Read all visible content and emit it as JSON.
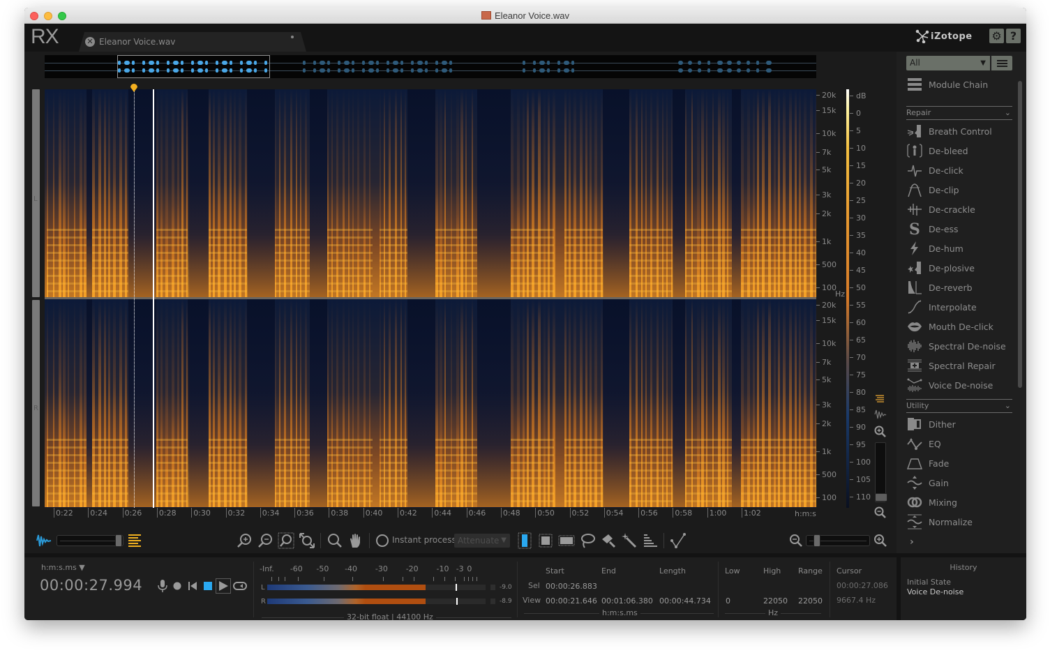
{
  "window": {
    "title": "Eleanor Voice.wav"
  },
  "app": {
    "logo": "RX",
    "brand": "iZotope",
    "settings_label": "⚙",
    "help_label": "?"
  },
  "file_tab": {
    "label": "Eleanor Voice.wav",
    "close_glyph": "✕"
  },
  "spectrogram": {
    "channels": [
      "L",
      "R"
    ],
    "freq_ticks": [
      "20k",
      "15k",
      "10k",
      "7k",
      "5k",
      "3k",
      "2k",
      "1k",
      "500",
      "100"
    ],
    "freq_unit": "Hz",
    "db_unit": "dB",
    "db_ticks": [
      "0",
      "5",
      "10",
      "15",
      "20",
      "25",
      "30",
      "35",
      "40",
      "45",
      "50",
      "55",
      "60",
      "65",
      "70",
      "75",
      "80",
      "85",
      "90",
      "95",
      "100",
      "105",
      "110"
    ],
    "time_ticks": [
      "0:22",
      "0:24",
      "0:26",
      "0:28",
      "0:30",
      "0:32",
      "0:34",
      "0:36",
      "0:38",
      "0:40",
      "0:42",
      "0:44",
      "0:46",
      "0:48",
      "0:50",
      "0:52",
      "0:54",
      "0:56",
      "0:58",
      "1:00",
      "1:02"
    ],
    "time_unit": "h:m:s",
    "colors": {
      "accent_orange": "#f0a020",
      "spectro_dark": "#0c1a38",
      "selection_blue": "#2aa8f0"
    }
  },
  "toolbar": {
    "instant_process_label": "Instant process",
    "attenuate_label": "Attenuate",
    "waveform_spectrogram_blend": 1.0
  },
  "modules": {
    "filter_value": "All",
    "module_chain_label": "Module Chain",
    "repair_header": "Repair",
    "utility_header": "Utility",
    "repair": [
      {
        "label": "Breath Control",
        "icon": "breath-icon"
      },
      {
        "label": "De-bleed",
        "icon": "mic-bleed-icon"
      },
      {
        "label": "De-click",
        "icon": "click-icon"
      },
      {
        "label": "De-clip",
        "icon": "clip-icon"
      },
      {
        "label": "De-crackle",
        "icon": "crackle-icon"
      },
      {
        "label": "De-ess",
        "icon": "ess-icon"
      },
      {
        "label": "De-hum",
        "icon": "bolt-icon"
      },
      {
        "label": "De-plosive",
        "icon": "plosive-icon"
      },
      {
        "label": "De-reverb",
        "icon": "reverb-icon"
      },
      {
        "label": "Interpolate",
        "icon": "interpolate-icon"
      },
      {
        "label": "Mouth De-click",
        "icon": "lips-icon"
      },
      {
        "label": "Spectral De-noise",
        "icon": "spectral-noise-icon"
      },
      {
        "label": "Spectral Repair",
        "icon": "spectral-repair-icon"
      },
      {
        "label": "Voice De-noise",
        "icon": "voice-noise-icon"
      }
    ],
    "utility": [
      {
        "label": "Dither",
        "icon": "dither-icon"
      },
      {
        "label": "EQ",
        "icon": "eq-icon"
      },
      {
        "label": "Fade",
        "icon": "fade-icon"
      },
      {
        "label": "Gain",
        "icon": "gain-icon"
      },
      {
        "label": "Mixing",
        "icon": "mixing-icon"
      },
      {
        "label": "Normalize",
        "icon": "normalize-icon"
      }
    ]
  },
  "transport": {
    "time_format": "h:m:s.ms ▼",
    "timecode": "00:00:27.994"
  },
  "meters": {
    "scale": [
      "-Inf.",
      "-60",
      "-50",
      "-40",
      "-30",
      "-20",
      "-10",
      "-3",
      "0"
    ],
    "left_label": "L",
    "right_label": "R",
    "left_peak": "-9.0",
    "right_peak": "-8.9",
    "left_level_db": -17,
    "right_level_db": -17,
    "format": "32-bit float | 44100 Hz"
  },
  "selection": {
    "headers": {
      "start": "Start",
      "end": "End",
      "length": "Length",
      "low": "Low",
      "high": "High",
      "range": "Range",
      "cursor": "Cursor"
    },
    "sel_label": "Sel",
    "view_label": "View",
    "sel_start": "00:00:26.883",
    "view_start": "00:00:21.646",
    "view_end": "00:01:06.380",
    "view_length": "00:00:44.734",
    "view_low": "0",
    "view_high": "22050",
    "view_range": "22050",
    "time_unit": "h:m:s.ms",
    "freq_unit": "Hz",
    "cursor_time": "00:00:27.086",
    "cursor_freq": "9667.4 Hz"
  },
  "history": {
    "title": "History",
    "items": [
      "Initial State",
      "Voice De-noise"
    ]
  }
}
